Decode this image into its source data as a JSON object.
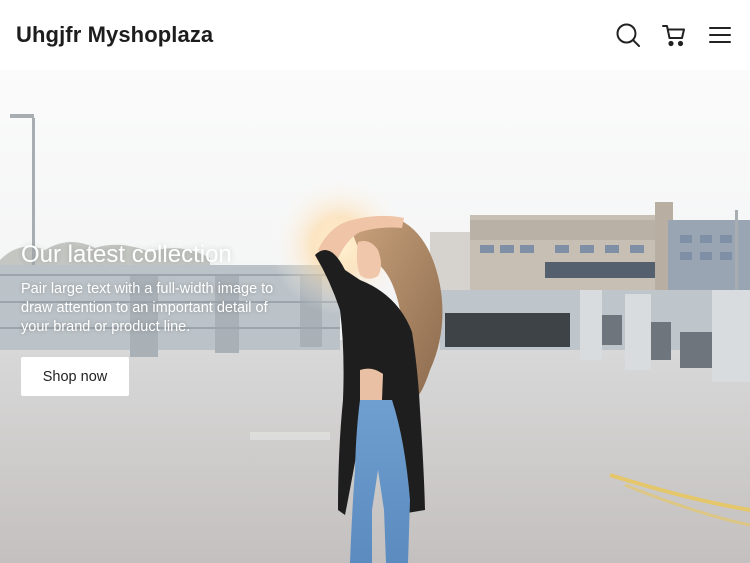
{
  "header": {
    "brand": "Uhgjfr Myshoplaza",
    "icons": [
      "search-icon",
      "cart-icon",
      "menu-icon"
    ]
  },
  "hero": {
    "title": "Our latest collection",
    "description": "Pair large text with a full-width image to draw attention to an important detail of your brand or product line.",
    "button_label": "Shop now"
  },
  "colors": {
    "header_bg": "#ffffff",
    "text_dark": "#1d1d1d",
    "hero_text": "#ffffff",
    "button_bg": "#ffffff"
  }
}
